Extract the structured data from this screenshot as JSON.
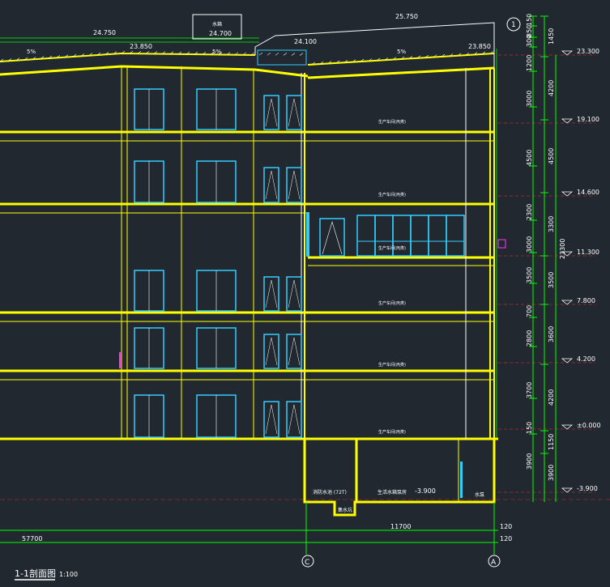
{
  "drawing": {
    "title": "1-1剖面图",
    "scale": "1:100",
    "background": "#212830"
  },
  "colors": {
    "structure": "#ffff00",
    "window": "#33ccff",
    "thin_line": "#ffffff",
    "dimension": "#00ff00",
    "level_text": "#ffffff",
    "axis_red": "#ff3333",
    "magenta": "#ff33ff"
  },
  "roof_levels": {
    "left_roof": "24.750",
    "ridge_left": "23.850",
    "water_tank_label": "水箱",
    "water_tank_level": "24.700",
    "mid": "24.100",
    "top": "25.750",
    "right_roof": "23.850"
  },
  "slopes": [
    "5%",
    "5%",
    "5%"
  ],
  "floor_labels": [
    "生产车间(丙类)",
    "生产车间(丙类)",
    "生产车间(丙类)",
    "生产车间(丙类)",
    "生产车间(丙类)",
    "生产车间(丙类)"
  ],
  "basement": {
    "room_left": "消防水池 (72T)",
    "room_mid": "生活水箱泵房",
    "level": "-3.900",
    "room_right": "水泵",
    "pit": "集水坑"
  },
  "elevations": [
    "23.300",
    "19.100",
    "14.600",
    "11.300",
    "7.800",
    "4.200",
    "±0.000",
    "-3.900"
  ],
  "dims_inner": [
    "150",
    "850",
    "300",
    "1200",
    "3000",
    "4500",
    "2300",
    "3000",
    "3500",
    "700",
    "2800",
    "3700",
    "150",
    "3900"
  ],
  "dims_outer": [
    "1450",
    "4200",
    "4500",
    "3300",
    "3500",
    "3600",
    "4200",
    "1150",
    "3900"
  ],
  "dim_total": "23300",
  "axis_top": "1",
  "axis_bottom": [
    "C",
    "A"
  ],
  "span_dim": "11700",
  "total_dim": "57700",
  "right_small_dims": [
    "120",
    "120"
  ]
}
